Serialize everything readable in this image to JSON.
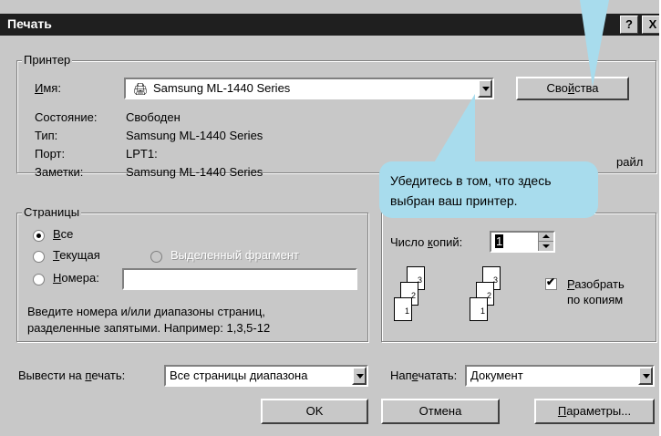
{
  "dialog": {
    "title": "Печать",
    "help_btn": "?",
    "close_btn": "X"
  },
  "printer": {
    "group_label": "Принтер",
    "name_label": "Имя:",
    "name_value": "Samsung ML-1440 Series",
    "properties_btn": "Свойства",
    "status_label": "Состояние:",
    "status_value": "Свободен",
    "type_label": "Тип:",
    "type_value": "Samsung ML-1440 Series",
    "port_label": "Порт:",
    "port_value": "LPT1:",
    "notes_label": "Заметки:",
    "notes_value": "Samsung ML-1440 Series",
    "print_to_file_partial": "райл"
  },
  "callout": {
    "line1": "Убедитесь в том, что здесь",
    "line2": "выбран ваш принтер."
  },
  "pages": {
    "group_label": "Страницы",
    "all": "Все",
    "current": "Текущая",
    "selection": "Выделенный фрагмент",
    "numbers": "Номера:",
    "numbers_value": "",
    "hint_line1": "Введите номера и/или диапазоны страниц,",
    "hint_line2": "разделенные запятыми. Например: 1,3,5-12"
  },
  "copies": {
    "count_label": "Число копий:",
    "count_value": "1",
    "collate_label_line1": "Разобрать",
    "collate_label_line2": "по копиям",
    "collate_checked": true,
    "page_nums": [
      "3",
      "2",
      "1"
    ]
  },
  "output": {
    "print_what_label": "Вывести на печать:",
    "print_what_value": "Все страницы диапазона",
    "print_label": "Напечатать:",
    "print_value": "Документ"
  },
  "buttons": {
    "ok": "OK",
    "cancel": "Отмена",
    "options": "Параметры..."
  },
  "colors": {
    "dialog_bg": "#c8c8c8",
    "titlebar": "#1f1f1f",
    "callout": "#a8dced"
  }
}
